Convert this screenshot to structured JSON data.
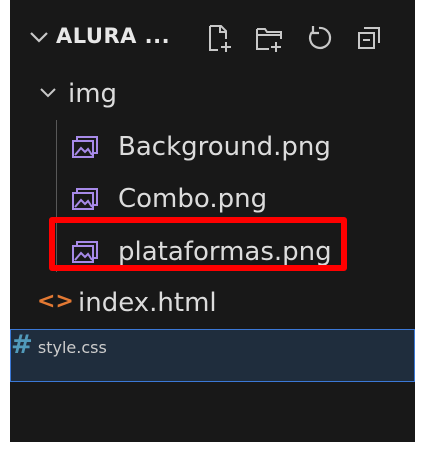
{
  "explorer": {
    "section_title": "ALURA ...",
    "actions": [
      {
        "name": "new-file-icon"
      },
      {
        "name": "new-folder-icon"
      },
      {
        "name": "refresh-icon"
      },
      {
        "name": "collapse-all-icon"
      }
    ],
    "tree": [
      {
        "label": "img",
        "kind": "folder",
        "expanded": true
      },
      {
        "label": "Background.png",
        "kind": "image"
      },
      {
        "label": "Combo.png",
        "kind": "image"
      },
      {
        "label": "plataformas.png",
        "kind": "image",
        "highlighted": true
      },
      {
        "label": "index.html",
        "kind": "html",
        "icon_glyph": "<>"
      },
      {
        "label": "style.css",
        "kind": "css",
        "icon_glyph": "#",
        "selected": true
      }
    ]
  },
  "colors": {
    "background": "#181818",
    "image_icon": "#a78ae8",
    "html_icon": "#e37933",
    "css_icon": "#519aba",
    "selection_border": "#3b78d6",
    "highlight_box": "#ff0000"
  }
}
